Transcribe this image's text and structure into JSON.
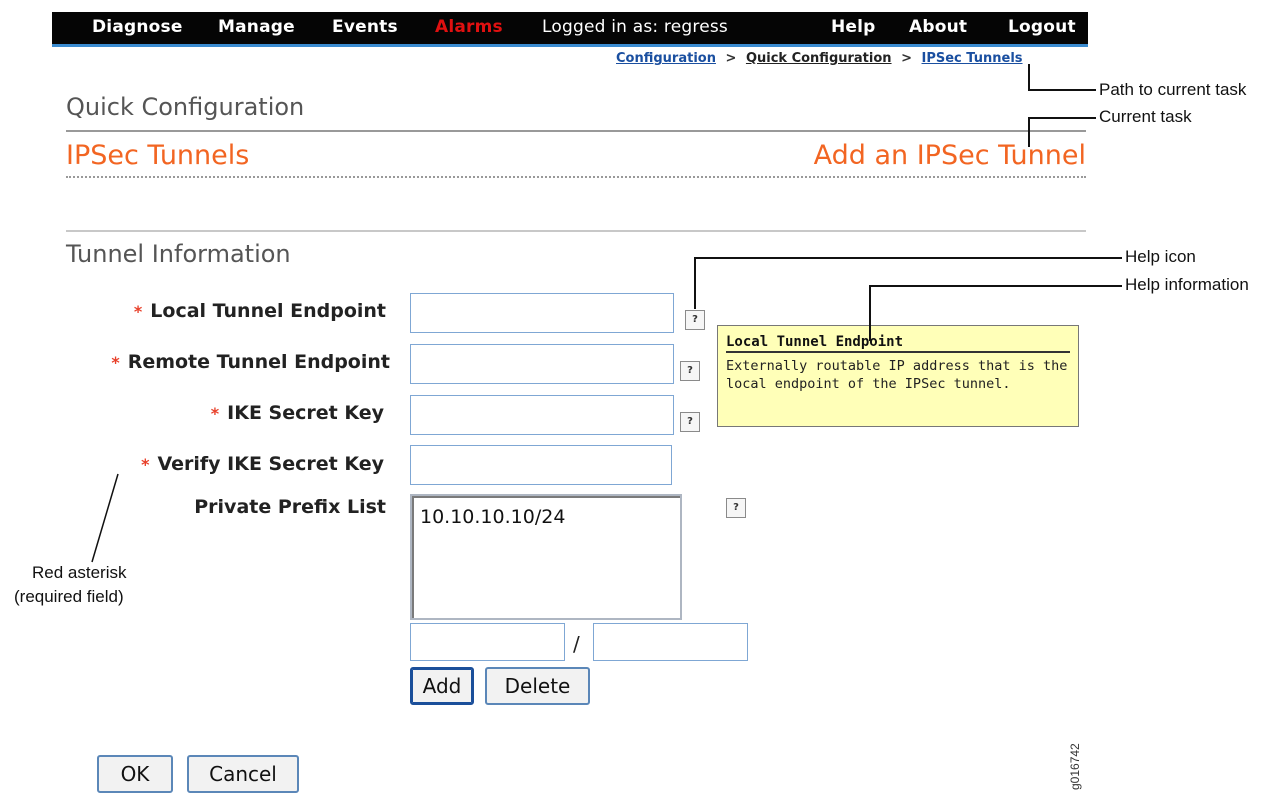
{
  "nav": {
    "diagnose": "Diagnose",
    "manage": "Manage",
    "events": "Events",
    "alarms": "Alarms",
    "logged_in": "Logged in as: regress",
    "help": "Help",
    "about": "About",
    "logout": "Logout"
  },
  "breadcrumb": {
    "configuration": "Configuration",
    "quick_configuration": "Quick Configuration",
    "ipsec_tunnels": "IPSec Tunnels",
    "separator": ">"
  },
  "page": {
    "title": "Quick Configuration",
    "section": "IPSec Tunnels",
    "current_task": "Add an IPSec Tunnel",
    "subsection": "Tunnel Information"
  },
  "form": {
    "required_marker": "*",
    "local_endpoint_label": "Local Tunnel Endpoint",
    "remote_endpoint_label": "Remote Tunnel Endpoint",
    "ike_key_label": "IKE Secret Key",
    "verify_key_label": "Verify IKE Secret Key",
    "prefix_list_label": "Private Prefix List",
    "prefix_list_items": [
      "10.10.10.10/24"
    ],
    "prefix_separator": "/",
    "add_label": "Add",
    "delete_label": "Delete",
    "ok_label": "OK",
    "cancel_label": "Cancel",
    "help_glyph": "?"
  },
  "tooltip": {
    "title": "Local Tunnel Endpoint",
    "body": "Externally routable IP address that is the local endpoint of the IPSec tunnel."
  },
  "callouts": {
    "path": "Path to current task",
    "current_task": "Current task",
    "help_icon": "Help icon",
    "help_info": "Help information",
    "asterisk_line1": "Red asterisk",
    "asterisk_line2": "(required field)"
  },
  "figure_id": "g016742",
  "colors": {
    "accent_orange": "#f26522",
    "required_red": "#e8402a",
    "alarm_red": "#e01010",
    "tooltip_bg": "#ffffb8",
    "nav_bg": "#050505"
  }
}
